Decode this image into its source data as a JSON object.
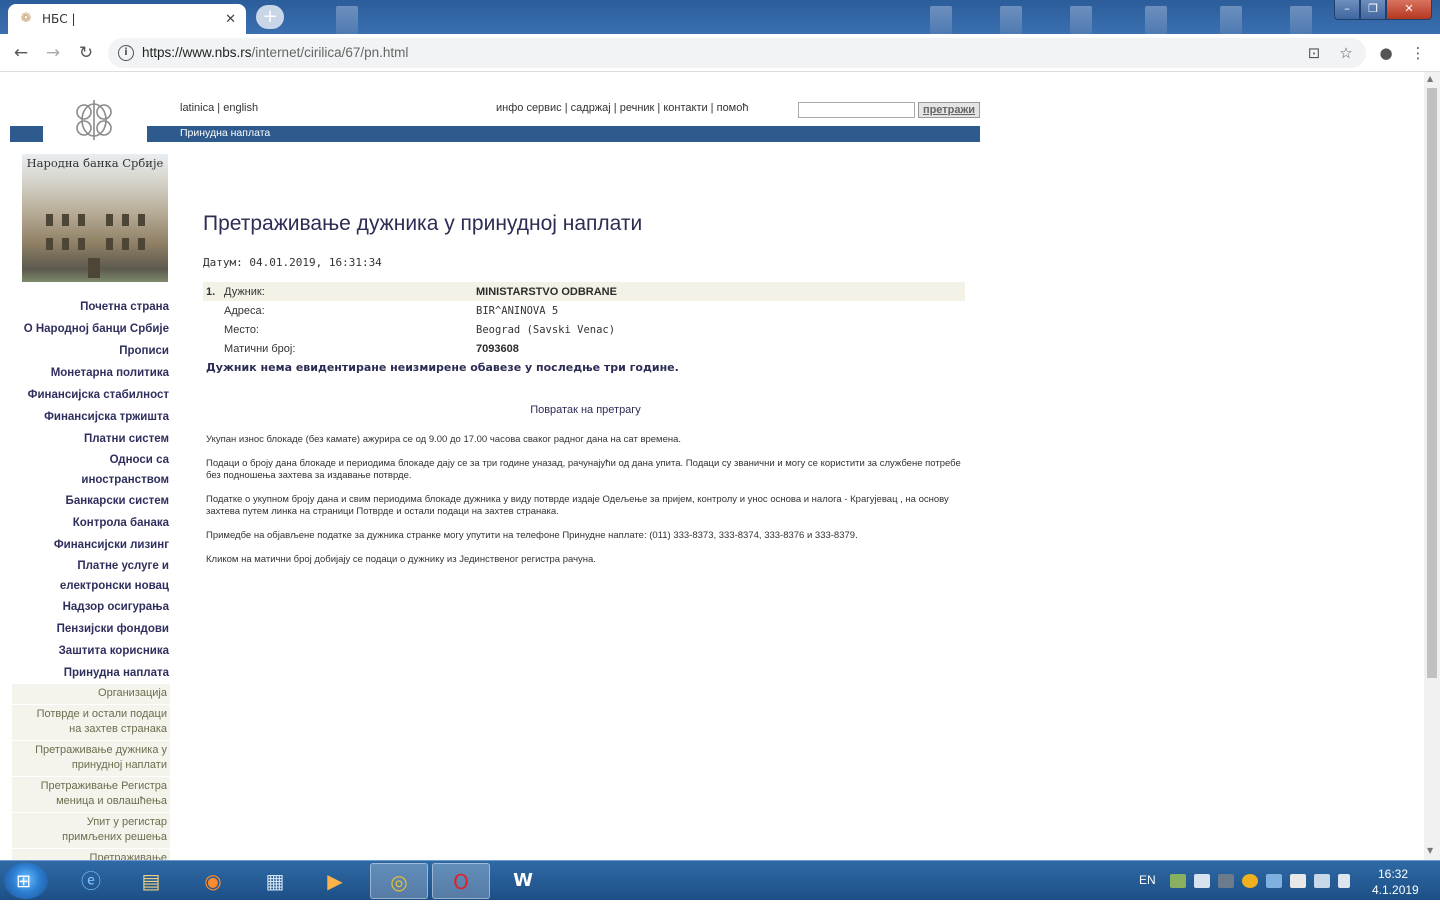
{
  "browser": {
    "tab_title": "НБС |",
    "url_host": "https://www.nbs.rs",
    "url_path": "/internet/cirilica/67/pn.html"
  },
  "header": {
    "lang_latin": "latinica",
    "lang_en": "english",
    "links": [
      "инфо сервис",
      "садржај",
      "речник",
      "контакти",
      "помоћ"
    ],
    "search_button": "претражи",
    "section": "Принудна наплата",
    "bank_caption": "Народна банка Србије"
  },
  "sidebar": {
    "items": [
      "Почетна страна",
      "О Народној банци Србије",
      "Прописи",
      "Монетарна политика",
      "Финансијска стабилност",
      "Финансијска тржишта",
      "Платни систем",
      "Односи са иностранством",
      "Банкарски систем",
      "Контрола банака",
      "Финансијски лизинг",
      "Платне услуге и електронски новац",
      "Надзор осигурања",
      "Пензијски фондови",
      "Заштита корисника",
      "Принудна наплата"
    ],
    "subitems": [
      "Организација",
      "Потврде и остали подаци на захтев странака",
      "Претраживање дужника у принудној наплати",
      "Претраживање Регистра меница и овлашћења",
      "Упит у регистар примљених решења",
      "Претраживање"
    ]
  },
  "main": {
    "title": "Претраживање дужника у принудној наплати",
    "date_label": "Датум: 04.01.2019, 16:31:34",
    "result": {
      "num": "1.",
      "debtor_label": "Дужник:",
      "debtor": "MINISTARSTVO ODBRANE",
      "address_label": "Адреса:",
      "address": "BIR^ANINOVA 5",
      "place_label": "Место:",
      "place": "Beograd (Savski Venac)",
      "id_label": "Матични број:",
      "id": "7093608"
    },
    "notice": "Дужник нема евидентиране неизмирене обавезе у последње три године.",
    "back_link": "Повратак на претрагу",
    "paragraphs": [
      "Укупан износ блокаде (без камате) ажурира се од 9.00 до 17.00 часова сваког радног дана на сат времена.",
      "Подаци о броју дана блокаде и периодима блокаде дају се за три године уназад, рачунајући од дана упита. Подаци су званични и могу се користити за службене потребе без подношења захтева за издавање потврде.",
      "Податке о укупном броју дана и свим периодима блокаде дужника у виду потврде издаје Одељење за пријем, контролу и унос основа и налога - Крагујевац , на основу захтева путем линка на страници Потврде и остали подаци на захтев странака.",
      "Примедбе на објављене податке за дужника странке могу упутити на телефоне Принудне наплате: (011) 333-8373, 333-8374, 333-8376 и 333-8379.",
      "Кликом на матични број добијају се подаци о дужнику из Јединственог регистра рачуна."
    ]
  },
  "taskbar": {
    "lang": "EN",
    "time": "16:32",
    "date": "4.1.2019"
  },
  "colors": {
    "nbs_blue": "#2e5a8e",
    "menu_text": "#2f2f5e",
    "row_highlight": "#f4f2e6"
  }
}
